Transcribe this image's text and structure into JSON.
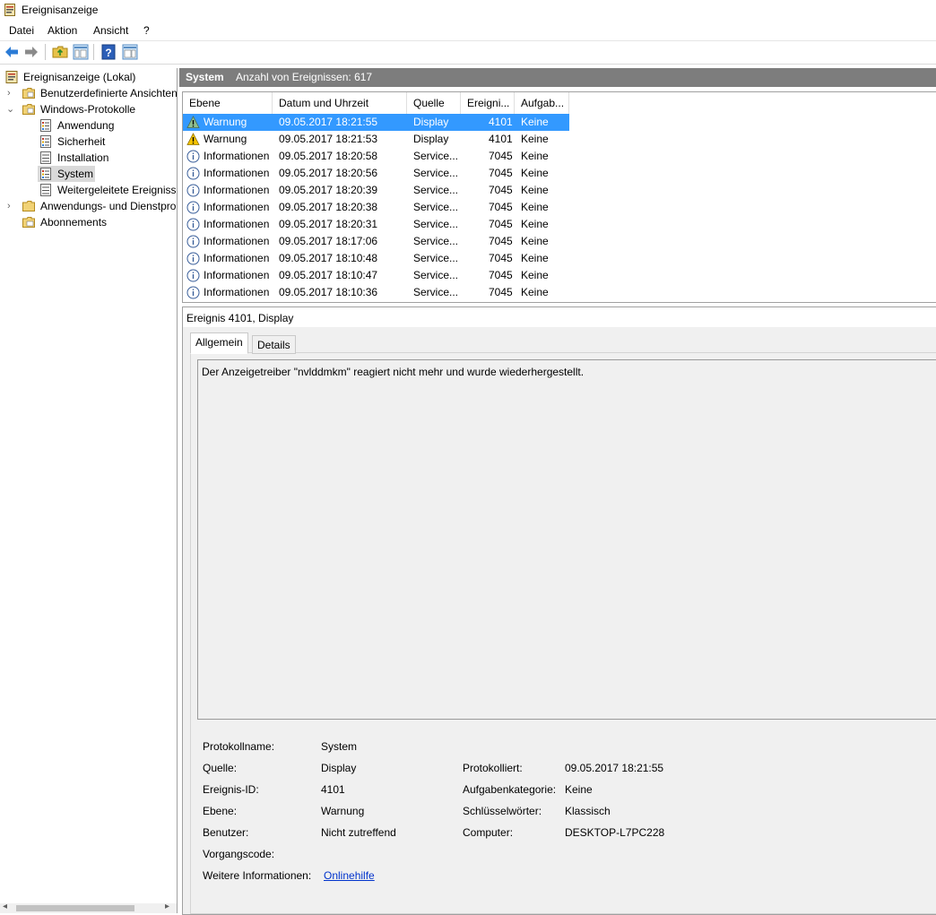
{
  "window": {
    "title": "Ereignisanzeige"
  },
  "menu": [
    "Datei",
    "Aktion",
    "Ansicht",
    "?"
  ],
  "toolbar": {
    "buttons": [
      "back-icon",
      "forward-icon",
      "folder-up-icon",
      "show-hide-tree-icon",
      "help-icon",
      "show-hide-action-icon"
    ]
  },
  "tree": {
    "root": "Ereignisanzeige (Lokal)",
    "custom_views": "Benutzerdefinierte Ansichten",
    "windows_logs": "Windows-Protokolle",
    "logs": [
      "Anwendung",
      "Sicherheit",
      "Installation",
      "System",
      "Weitergeleitete Ereignisse"
    ],
    "app_service_logs": "Anwendungs- und Dienstprotokolle",
    "subscriptions": "Abonnements"
  },
  "header": {
    "title": "System",
    "count": "Anzahl von Ereignissen: 617"
  },
  "table": {
    "columns": [
      "Ebene",
      "Datum und Uhrzeit",
      "Quelle",
      "Ereigni...",
      "Aufgab..."
    ],
    "rows": [
      {
        "level": "Warnung",
        "icon": "warning-icon",
        "date": "09.05.2017 18:21:55",
        "source": "Display",
        "id": "4101",
        "task": "Keine",
        "selected": true
      },
      {
        "level": "Warnung",
        "icon": "warning-icon",
        "date": "09.05.2017 18:21:53",
        "source": "Display",
        "id": "4101",
        "task": "Keine"
      },
      {
        "level": "Informationen",
        "icon": "info-icon",
        "date": "09.05.2017 18:20:58",
        "source": "Service...",
        "id": "7045",
        "task": "Keine"
      },
      {
        "level": "Informationen",
        "icon": "info-icon",
        "date": "09.05.2017 18:20:56",
        "source": "Service...",
        "id": "7045",
        "task": "Keine"
      },
      {
        "level": "Informationen",
        "icon": "info-icon",
        "date": "09.05.2017 18:20:39",
        "source": "Service...",
        "id": "7045",
        "task": "Keine"
      },
      {
        "level": "Informationen",
        "icon": "info-icon",
        "date": "09.05.2017 18:20:38",
        "source": "Service...",
        "id": "7045",
        "task": "Keine"
      },
      {
        "level": "Informationen",
        "icon": "info-icon",
        "date": "09.05.2017 18:20:31",
        "source": "Service...",
        "id": "7045",
        "task": "Keine"
      },
      {
        "level": "Informationen",
        "icon": "info-icon",
        "date": "09.05.2017 18:17:06",
        "source": "Service...",
        "id": "7045",
        "task": "Keine"
      },
      {
        "level": "Informationen",
        "icon": "info-icon",
        "date": "09.05.2017 18:10:48",
        "source": "Service...",
        "id": "7045",
        "task": "Keine"
      },
      {
        "level": "Informationen",
        "icon": "info-icon",
        "date": "09.05.2017 18:10:47",
        "source": "Service...",
        "id": "7045",
        "task": "Keine"
      },
      {
        "level": "Informationen",
        "icon": "info-icon",
        "date": "09.05.2017 18:10:36",
        "source": "Service...",
        "id": "7045",
        "task": "Keine"
      }
    ]
  },
  "detail": {
    "title": "Ereignis 4101, Display",
    "tabs": [
      "Allgemein",
      "Details"
    ],
    "message": "Der Anzeigetreiber \"nvlddmkm\" reagiert nicht mehr und wurde wiederhergestellt.",
    "labels": {
      "log_name": "Protokollname:",
      "source": "Quelle:",
      "event_id": "Ereignis-ID:",
      "level": "Ebene:",
      "user": "Benutzer:",
      "opcode": "Vorgangscode:",
      "more_info": "Weitere Informationen:",
      "logged": "Protokolliert:",
      "task_category": "Aufgabenkategorie:",
      "keywords": "Schlüsselwörter:",
      "computer": "Computer:"
    },
    "values": {
      "log_name": "System",
      "source": "Display",
      "event_id": "4101",
      "level": "Warnung",
      "user": "Nicht zutreffend",
      "more_info_link": "Onlinehilfe",
      "logged": "09.05.2017 18:21:55",
      "task_category": "Keine",
      "keywords": "Klassisch",
      "computer": "DESKTOP-L7PC228"
    }
  }
}
